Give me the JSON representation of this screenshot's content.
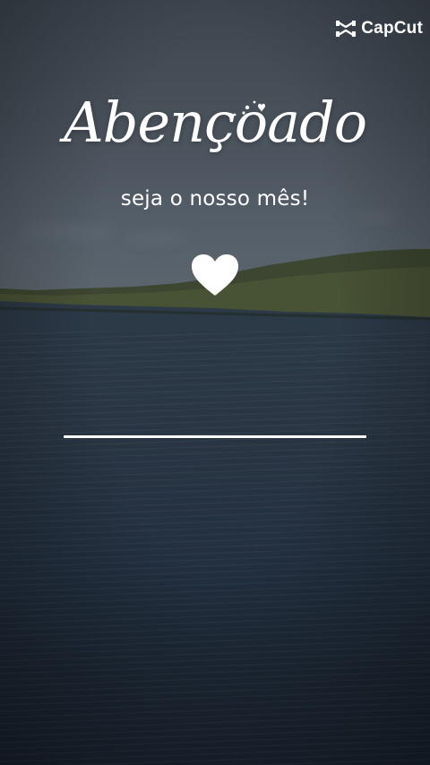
{
  "brand": {
    "logo_text": "CapCut",
    "logo_icon": "capcut-logo-icon"
  },
  "card": {
    "title": "Abençoado",
    "subtitle": "seja o nosso mês!",
    "heart_icon": "heart-icon",
    "sparkle_icon": "sparkle-icon"
  },
  "colors": {
    "text": "#ffffff",
    "sky": "#4a525c",
    "water": "#233040",
    "hills": "#3d4a2a"
  }
}
